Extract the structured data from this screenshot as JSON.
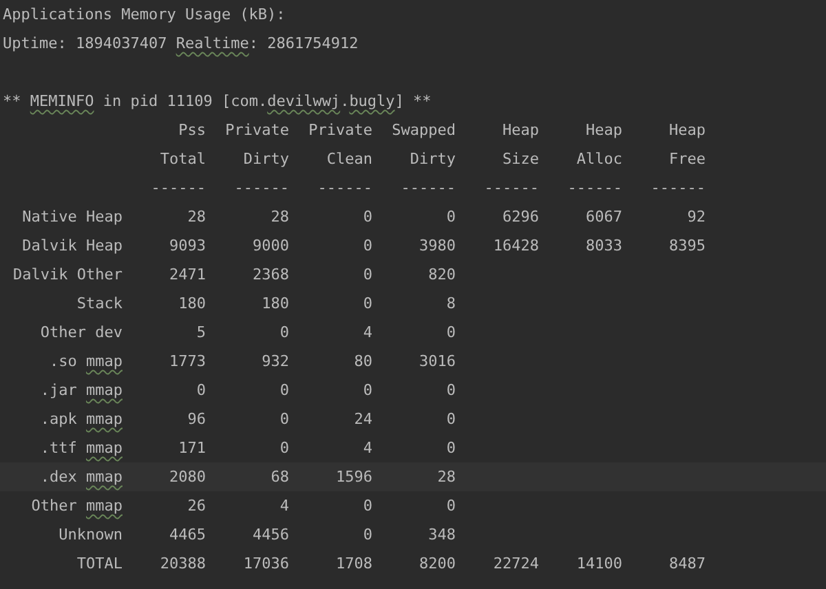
{
  "lines": [
    {
      "blank_before": false,
      "segments": [
        {
          "text": "Applications Memory Usage (kB):",
          "flagged": false
        }
      ]
    },
    {
      "blank_before": false,
      "segments": [
        {
          "text": "Uptime: 1894037407 ",
          "flagged": false
        },
        {
          "text": "Realtime",
          "flagged": true
        },
        {
          "text": ": 2861754912",
          "flagged": false
        }
      ]
    },
    {
      "blank_before": true,
      "segments": [
        {
          "text": "** ",
          "flagged": false
        },
        {
          "text": "MEMINFO",
          "flagged": true
        },
        {
          "text": " in pid 11109 [com.",
          "flagged": false
        },
        {
          "text": "devilwwj",
          "flagged": true
        },
        {
          "text": ".",
          "flagged": false
        },
        {
          "text": "bugly",
          "flagged": true
        },
        {
          "text": "] **",
          "flagged": false
        }
      ]
    }
  ],
  "table": {
    "header_rows": [
      [
        "Pss",
        "Private",
        "Private",
        "Swapped",
        "Heap",
        "Heap",
        "Heap"
      ],
      [
        "Total",
        "Dirty",
        "Clean",
        "Dirty",
        "Size",
        "Alloc",
        "Free"
      ],
      [
        "------",
        "------",
        "------",
        "------",
        "------",
        "------",
        "------"
      ]
    ],
    "rows": [
      {
        "label": [
          {
            "text": "Native Heap",
            "flagged": false
          }
        ],
        "values": [
          "28",
          "28",
          "0",
          "0",
          "6296",
          "6067",
          "92"
        ],
        "current_line": false
      },
      {
        "label": [
          {
            "text": "Dalvik Heap",
            "flagged": false
          }
        ],
        "values": [
          "9093",
          "9000",
          "0",
          "3980",
          "16428",
          "8033",
          "8395"
        ],
        "current_line": false
      },
      {
        "label": [
          {
            "text": "Dalvik Other",
            "flagged": false
          }
        ],
        "values": [
          "2471",
          "2368",
          "0",
          "820"
        ],
        "current_line": false
      },
      {
        "label": [
          {
            "text": "Stack",
            "flagged": false
          }
        ],
        "values": [
          "180",
          "180",
          "0",
          "8"
        ],
        "current_line": false
      },
      {
        "label": [
          {
            "text": "Other dev",
            "flagged": false
          }
        ],
        "values": [
          "5",
          "0",
          "4",
          "0"
        ],
        "current_line": false
      },
      {
        "label": [
          {
            "text": ".so ",
            "flagged": false
          },
          {
            "text": "mmap",
            "flagged": true
          }
        ],
        "values": [
          "1773",
          "932",
          "80",
          "3016"
        ],
        "current_line": false
      },
      {
        "label": [
          {
            "text": ".jar ",
            "flagged": false
          },
          {
            "text": "mmap",
            "flagged": true
          }
        ],
        "values": [
          "0",
          "0",
          "0",
          "0"
        ],
        "current_line": false
      },
      {
        "label": [
          {
            "text": ".apk ",
            "flagged": false
          },
          {
            "text": "mmap",
            "flagged": true
          }
        ],
        "values": [
          "96",
          "0",
          "24",
          "0"
        ],
        "current_line": false
      },
      {
        "label": [
          {
            "text": ".ttf ",
            "flagged": false
          },
          {
            "text": "mmap",
            "flagged": true
          }
        ],
        "values": [
          "171",
          "0",
          "4",
          "0"
        ],
        "current_line": false
      },
      {
        "label": [
          {
            "text": ".dex ",
            "flagged": false
          },
          {
            "text": "mmap",
            "flagged": true
          }
        ],
        "values": [
          "2080",
          "68",
          "1596",
          "28"
        ],
        "current_line": true
      },
      {
        "label": [
          {
            "text": "Other ",
            "flagged": false
          },
          {
            "text": "mmap",
            "flagged": true
          }
        ],
        "values": [
          "26",
          "4",
          "0",
          "0"
        ],
        "current_line": false
      },
      {
        "label": [
          {
            "text": "Unknown",
            "flagged": false
          }
        ],
        "values": [
          "4465",
          "4456",
          "0",
          "348"
        ],
        "current_line": false
      },
      {
        "label": [
          {
            "text": "TOTAL",
            "flagged": false
          }
        ],
        "values": [
          "20388",
          "17036",
          "1708",
          "8200",
          "22724",
          "14100",
          "8487"
        ],
        "current_line": false
      }
    ]
  }
}
